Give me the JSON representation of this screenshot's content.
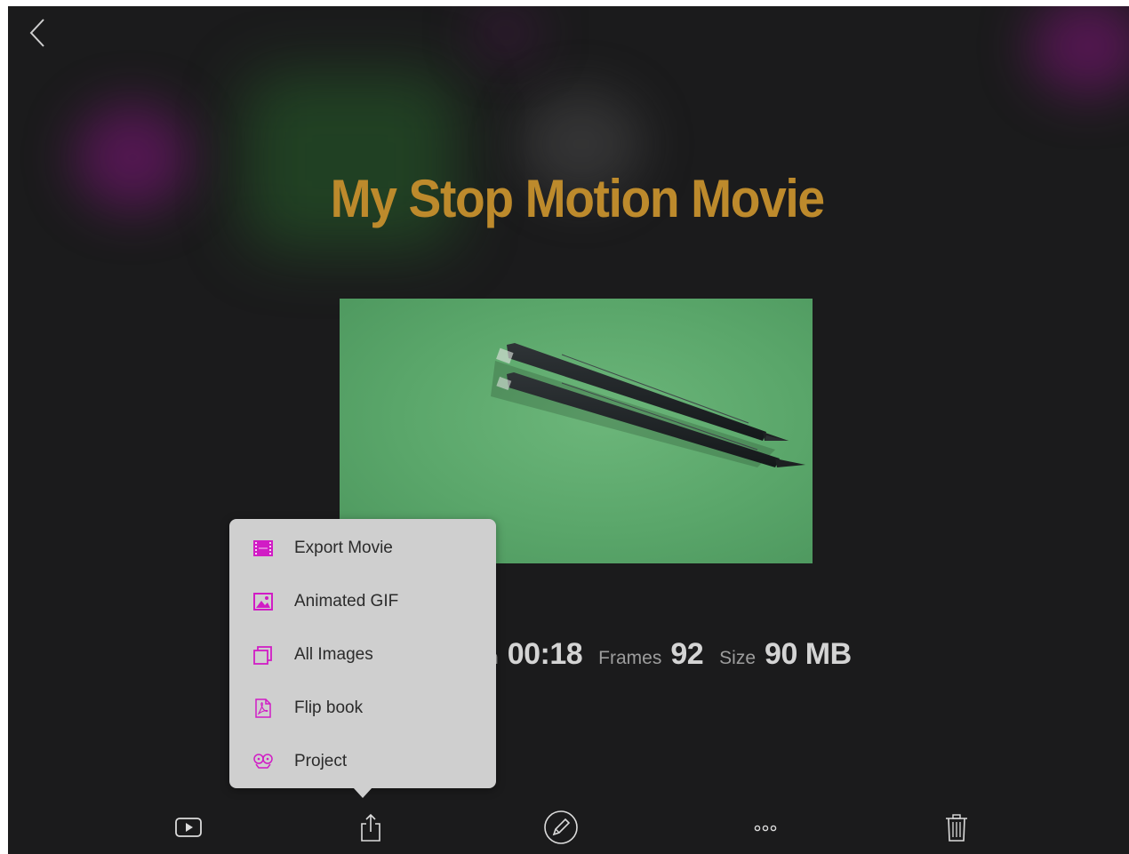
{
  "project": {
    "title": "My Stop Motion Movie"
  },
  "stats": {
    "duration_label_partial": "n",
    "duration_value": "00:18",
    "frames_label": "Frames",
    "frames_value": "92",
    "size_label": "Size",
    "size_value": "90 MB"
  },
  "share_menu": {
    "items": [
      {
        "label": "Export Movie",
        "icon": "film-icon"
      },
      {
        "label": "Animated GIF",
        "icon": "image-icon"
      },
      {
        "label": "All Images",
        "icon": "stacked-images-icon"
      },
      {
        "label": "Flip book",
        "icon": "pdf-icon"
      },
      {
        "label": "Project",
        "icon": "film-reel-icon"
      }
    ]
  },
  "toolbar": {
    "items": [
      "play-icon",
      "share-icon",
      "edit-icon",
      "more-icon",
      "trash-icon"
    ]
  },
  "colors": {
    "background": "#1b1b1c",
    "title": "#bd8a2c",
    "accent_icons": "#d11cc5",
    "popover": "#cfcfcf",
    "toolbar_icons": "#dcdcdc"
  }
}
